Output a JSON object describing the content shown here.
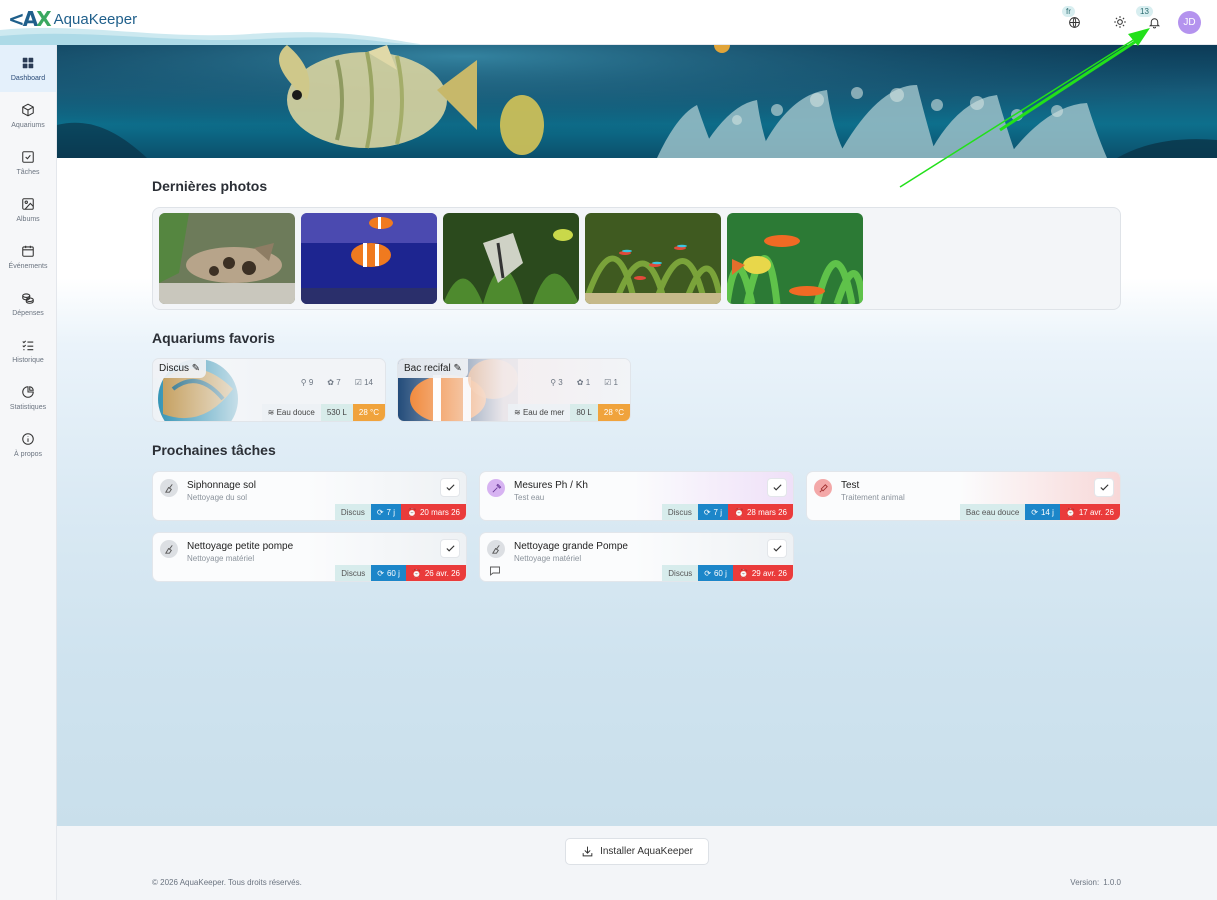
{
  "header": {
    "logo_text": "AquaKeeper",
    "lang_badge": "fr",
    "notif_count": "13",
    "avatar_initials": "JD"
  },
  "sidebar": {
    "items": [
      {
        "label": "Dashboard",
        "icon": "grid-icon"
      },
      {
        "label": "Aquariums",
        "icon": "cube-icon"
      },
      {
        "label": "Tâches",
        "icon": "checkbox-icon"
      },
      {
        "label": "Albums",
        "icon": "image-icon"
      },
      {
        "label": "Événements",
        "icon": "calendar-icon"
      },
      {
        "label": "Dépenses",
        "icon": "coins-icon"
      },
      {
        "label": "Historique",
        "icon": "list-check-icon"
      },
      {
        "label": "Statistiques",
        "icon": "pie-chart-icon"
      },
      {
        "label": "À propos",
        "icon": "info-icon"
      }
    ]
  },
  "sections": {
    "photos_title": "Dernières photos",
    "favorites_title": "Aquariums favoris",
    "tasks_title": "Prochaines tâches"
  },
  "photos": [
    {
      "subject": "corydoras"
    },
    {
      "subject": "clownfish"
    },
    {
      "subject": "angelfish"
    },
    {
      "subject": "neon-tetras"
    },
    {
      "subject": "guppy"
    }
  ],
  "aquariums": [
    {
      "name": "Discus",
      "stat_fish": "9",
      "stat_plants": "7",
      "stat_tasks": "14",
      "type": "Eau douce",
      "volume": "530 L",
      "temp": "28 °C"
    },
    {
      "name": "Bac recifal",
      "stat_fish": "3",
      "stat_plants": "1",
      "stat_tasks": "1",
      "type": "Eau de mer",
      "volume": "80 L",
      "temp": "28 °C"
    }
  ],
  "tasks": [
    {
      "title": "Siphonnage sol",
      "sub": "Nettoyage du sol",
      "aquarium": "Discus",
      "recurrence": "7 j",
      "due": "20 mars 26"
    },
    {
      "title": "Mesures Ph / Kh",
      "sub": "Test eau",
      "aquarium": "Discus",
      "recurrence": "7 j",
      "due": "28 mars 26"
    },
    {
      "title": "Test",
      "sub": "Traitement animal",
      "aquarium": "Bac eau douce",
      "recurrence": "14 j",
      "due": "17 avr. 26"
    },
    {
      "title": "Nettoyage petite pompe",
      "sub": "Nettoyage matériel",
      "aquarium": "Discus",
      "recurrence": "60 j",
      "due": "26 avr. 26"
    },
    {
      "title": "Nettoyage grande Pompe",
      "sub": "Nettoyage matériel",
      "aquarium": "Discus",
      "recurrence": "60 j",
      "due": "29 avr. 26"
    }
  ],
  "footer": {
    "install_label": "Installer AquaKeeper",
    "copyright": "© 2026 AquaKeeper. Tous droits réservés.",
    "version_label": "Version:",
    "version_value": "1.0.0"
  },
  "colors": {
    "accent": "#1c86c9",
    "due": "#ea3b3b",
    "temp": "#f0a33c",
    "annotation_arrow": "#22e01a"
  }
}
